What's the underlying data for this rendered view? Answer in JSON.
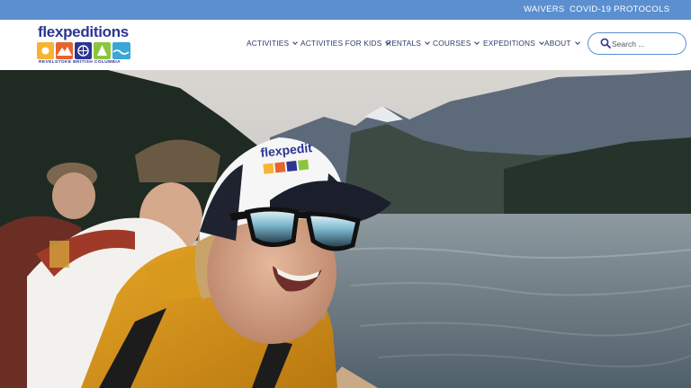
{
  "topbar": {
    "links": [
      {
        "label": "WAIVERS"
      },
      {
        "label": "COVID-19 PROTOCOLS"
      }
    ]
  },
  "brand": {
    "name": "flexpeditions",
    "tagline": "REVELSTOKE BRITISH COLUMBIA",
    "colors": {
      "primary": "#2c3591",
      "topbar": "#5b8fd0"
    }
  },
  "nav": {
    "items": [
      {
        "label": "ACTIVITIES"
      },
      {
        "label": "ACTIVITIES FOR KIDS"
      },
      {
        "label": "RENTALS"
      },
      {
        "label": "COURSES"
      },
      {
        "label": "EXPEDITIONS"
      },
      {
        "label": "ABOUT"
      }
    ]
  },
  "search": {
    "placeholder": "Search ...",
    "value": ""
  },
  "hero": {
    "cap_text": "flexpedit"
  }
}
